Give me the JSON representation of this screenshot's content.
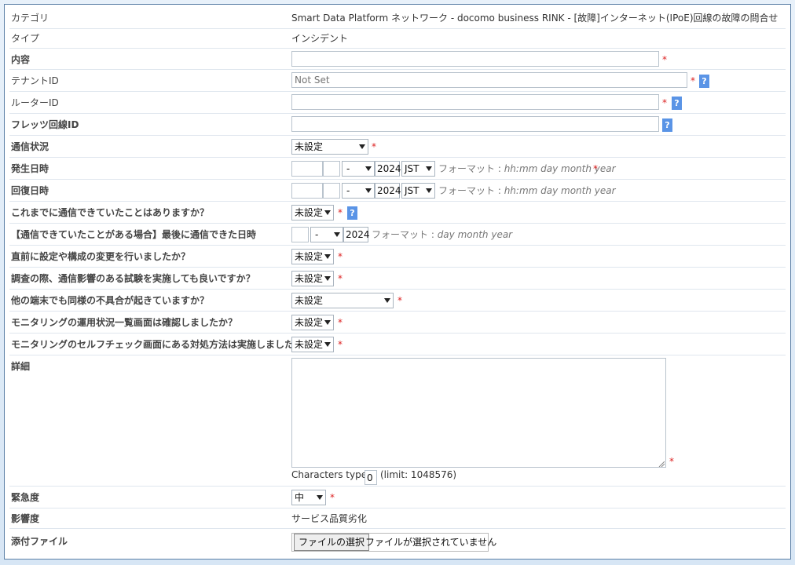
{
  "rows": {
    "category": {
      "label": "カテゴリ",
      "value": "Smart Data Platform ネットワーク - docomo business RINK - [故障]インターネット(IPoE)回線の故障の問合せ"
    },
    "type": {
      "label": "タイプ",
      "value": "インシデント"
    },
    "content": {
      "label": "内容",
      "value": ""
    },
    "tenant_id": {
      "label": "テナントID",
      "placeholder": "Not Set"
    },
    "router_id": {
      "label": "ルーターID",
      "value": ""
    },
    "flets_id": {
      "label": "フレッツ回線ID",
      "value": ""
    },
    "comm_status": {
      "label": "通信状況",
      "selected": "未設定"
    },
    "occurred": {
      "label": "発生日時",
      "day_selected": "-",
      "year": "2024",
      "tz_selected": "JST",
      "format_prefix": "フォーマット :",
      "format": "hh:mm day month year"
    },
    "recovered": {
      "label": "回復日時",
      "day_selected": "-",
      "year": "2024",
      "tz_selected": "JST",
      "format_prefix": "フォーマット :",
      "format": "hh:mm day month year"
    },
    "could_comm_before": {
      "label": "これまでに通信できていたことはありますか？",
      "selected": "未設定"
    },
    "last_comm": {
      "label": "【通信できていたことがある場合】最後に通信できた日時",
      "day_selected": "-",
      "year": "2024",
      "format_prefix": "フォーマット :",
      "format": "day month year"
    },
    "config_change": {
      "label": "直前に設定や構成の変更を行いましたか？",
      "selected": "未設定"
    },
    "test_ok": {
      "label": "調査の際、通信影響のある試験を実施しても良いですか？",
      "selected": "未設定"
    },
    "other_terminal": {
      "label": "他の端末でも同様の不具合が起きていますか？",
      "selected": "未設定"
    },
    "monitor_list": {
      "label": "モニタリングの運用状況一覧画面は確認しましたか？",
      "selected": "未設定"
    },
    "self_check": {
      "label": "モニタリングのセルフチェック画面にある対処方法は実施しましたか？",
      "selected": "未設定"
    },
    "details": {
      "label": "詳細",
      "chars_label": "Characters typed:",
      "chars_count": "0",
      "limit_text": "(limit: 1048576)"
    },
    "urgency": {
      "label": "緊急度",
      "selected": "中"
    },
    "impact": {
      "label": "影響度",
      "value": "サービス品質劣化"
    },
    "attachment": {
      "label": "添付ファイル",
      "button": "ファイルの選択",
      "status": "ファイルが選択されていません"
    }
  },
  "required_mark": "*",
  "help_mark": "?",
  "colors": {
    "required": "#dd2222",
    "help_bg": "#5a94e6",
    "border": "#5b7fa6"
  }
}
